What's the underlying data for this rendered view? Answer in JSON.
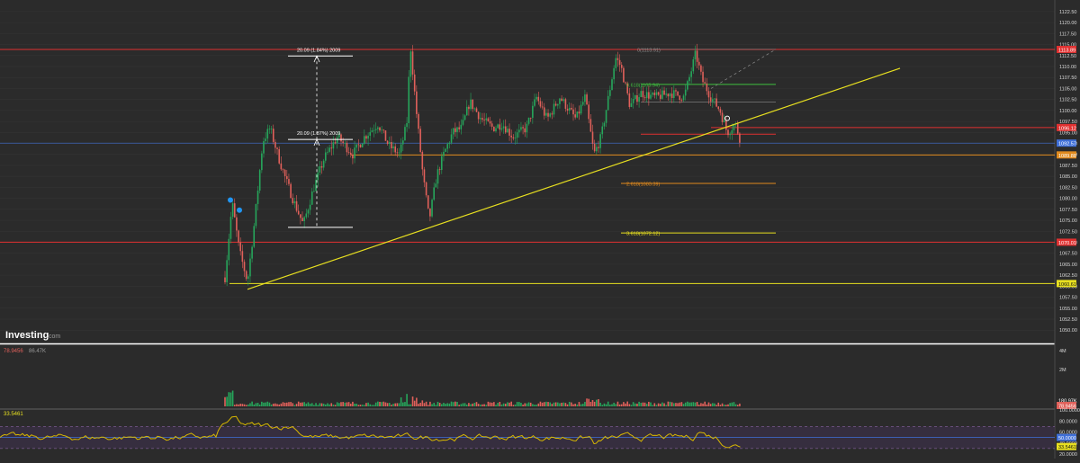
{
  "branding": {
    "logo_text": "Investing",
    "logo_suffix": ".com"
  },
  "colors": {
    "background": "#2b2b2b",
    "grid": "#363636",
    "candle_up": "#26a65b",
    "candle_down": "#e0605a",
    "red_level": "#e03131",
    "orange_level": "#e08a1e",
    "yellow_line": "#e8e020",
    "blue_line": "#3f6fd8",
    "green_fib": "#3fbf3f",
    "axis_text": "#d8d8d8",
    "rsi_line": "#d8b800",
    "rsi_band": "#3a2f45"
  },
  "chart_data": [
    {
      "type": "candlestick",
      "panel": "price",
      "ylim": [
        1048,
        1123.5
      ],
      "y_tick_labels": [
        "1122.50",
        "1120.00",
        "1117.50",
        "1115.00",
        "1112.50",
        "1110.00",
        "1107.50",
        "1105.00",
        "1102.50",
        "1100.00",
        "1097.50",
        "1095.00",
        "1092.50",
        "1090.00",
        "1087.50",
        "1085.00",
        "1082.50",
        "1080.00",
        "1077.50",
        "1075.00",
        "1072.50",
        "1070.00",
        "1067.50",
        "1065.00",
        "1062.50",
        "1060.00",
        "1057.50",
        "1055.00",
        "1052.50",
        "1050.00"
      ],
      "price_tags": [
        {
          "label": "1113.89",
          "value": 1113.89,
          "color": "#e03131"
        },
        {
          "label": "1096.12",
          "value": 1096.12,
          "color": "#e03131"
        },
        {
          "label": "1092.57",
          "value": 1092.57,
          "color": "#3f6fd8"
        },
        {
          "label": "1089.88",
          "value": 1089.88,
          "color": "#e08a1e"
        },
        {
          "label": "1070.01",
          "value": 1070.01,
          "color": "#e03131"
        },
        {
          "label": "1060.61",
          "value": 1060.61,
          "color": "#e8e020"
        }
      ],
      "fib_labels": [
        {
          "text": "0(1113.91)",
          "value": 1113.91,
          "color": "#8c8c8c"
        },
        {
          "text": "0.618(1105.94)",
          "value": 1105.94,
          "color": "#3fbf3f"
        },
        {
          "text": "2.618(1083.39)",
          "value": 1083.39,
          "color": "#e08a1e"
        },
        {
          "text": "3.618(1072.12)",
          "value": 1072.12,
          "color": "#e8e020"
        }
      ],
      "measure_labels": [
        "20.09 (1.84%) 2009",
        "20.09 (1.87%) 2009"
      ]
    },
    {
      "type": "bar",
      "panel": "volume",
      "series_label_left": [
        "78.9456",
        "86.47K"
      ],
      "y_tick_labels": [
        "4M",
        "2M"
      ],
      "price_tags": [
        {
          "label": "180.97K",
          "color": "#ffffff"
        },
        {
          "label": "78.9456",
          "color": "#e0605a"
        }
      ]
    },
    {
      "type": "line",
      "panel": "rsi",
      "series_label_left": "33.5461",
      "ylim": [
        20,
        100
      ],
      "y_tick_labels": [
        "100.0000",
        "80.0000",
        "60.0000",
        "40.0000",
        "20.0000"
      ],
      "levels": [
        70,
        50,
        30
      ],
      "price_tags": [
        {
          "label": "50.0000",
          "value": 50,
          "color": "#3f6fd8"
        },
        {
          "label": "33.5461",
          "value": 33.5461,
          "color": "#e8e020"
        }
      ]
    }
  ]
}
